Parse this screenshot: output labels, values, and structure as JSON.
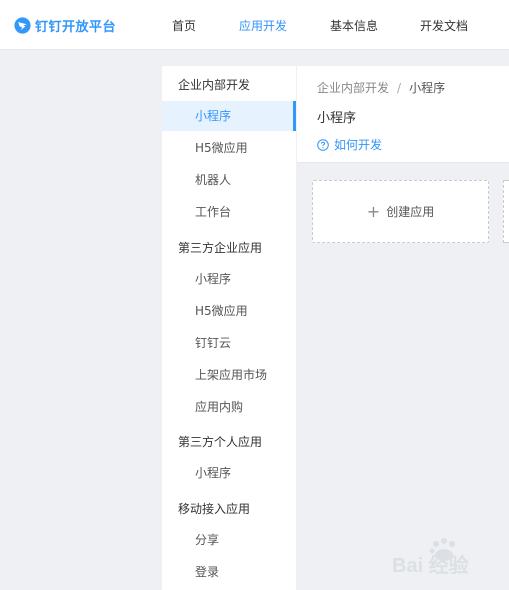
{
  "brand": {
    "logo_text": "钉钉开放平台",
    "accent_color": "#3296fa"
  },
  "nav": {
    "items": [
      "首页",
      "应用开发",
      "基本信息",
      "开发文档"
    ],
    "active_index": 1
  },
  "sidebar": {
    "groups": [
      {
        "title": "企业内部开发",
        "items": [
          "小程序",
          "H5微应用",
          "机器人",
          "工作台"
        ]
      },
      {
        "title": "第三方企业应用",
        "items": [
          "小程序",
          "H5微应用",
          "钉钉云",
          "上架应用市场",
          "应用内购"
        ]
      },
      {
        "title": "第三方个人应用",
        "items": [
          "小程序"
        ]
      },
      {
        "title": "移动接入应用",
        "items": [
          "分享",
          "登录"
        ]
      }
    ],
    "active": "企业内部开发 / 小程序"
  },
  "content": {
    "breadcrumb": [
      "企业内部开发",
      "小程序"
    ],
    "breadcrumb_separator": "/",
    "title": "小程序",
    "howto_link": "如何开发",
    "create_button": "创建应用"
  },
  "watermark": {
    "text": "Bai 经验"
  }
}
